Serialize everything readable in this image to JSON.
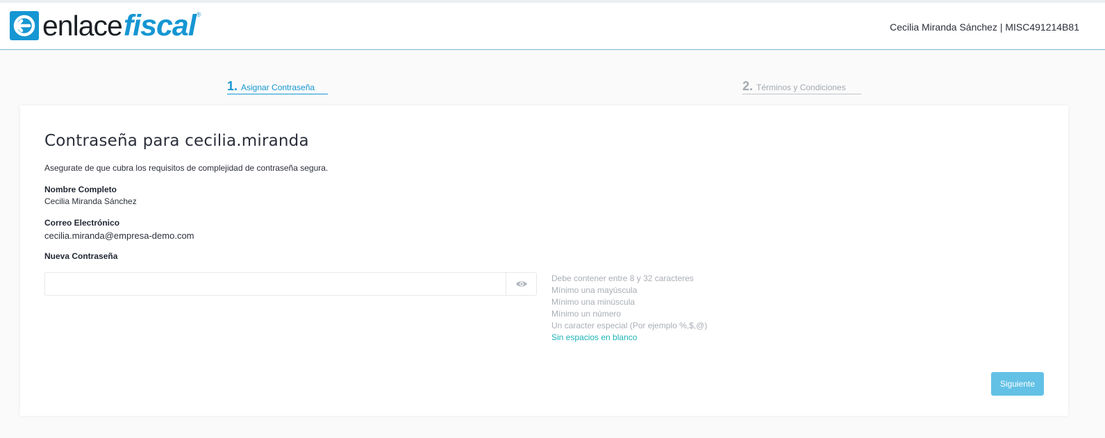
{
  "header": {
    "logo_text_primary": "enlace",
    "logo_text_accent": "fiscal",
    "logo_registered": "®",
    "user_info": "Cecilia Miranda Sánchez | MISC491214B81"
  },
  "steps": [
    {
      "number": "1.",
      "label": "Asignar Contraseña",
      "active": true
    },
    {
      "number": "2.",
      "label": "Términos y Condiciones",
      "active": false
    }
  ],
  "form": {
    "title": "Contraseña para cecilia.miranda",
    "description": "Asegurate de que cubra los requisitos de complejidad de contraseña segura.",
    "full_name_label": "Nombre Completo",
    "full_name_value": "Cecilia Miranda Sánchez",
    "email_label": "Correo Electrónico",
    "email_value": "cecilia.miranda@empresa-demo.com",
    "password_label": "Nueva Contraseña",
    "password_value": "",
    "password_placeholder": "",
    "toggle_icon": "eye-icon",
    "rules": [
      {
        "text": "Debe contener entre 8 y 32 caracteres",
        "met": false
      },
      {
        "text": "Mínimo una mayúscula",
        "met": false
      },
      {
        "text": "Mínimo una minúscula",
        "met": false
      },
      {
        "text": "Mínimo un número",
        "met": false
      },
      {
        "text": "Un caracter especial (Por ejemplo %,$,@)",
        "met": false
      },
      {
        "text": "Sin espacios en blanco",
        "met": true
      }
    ],
    "next_label": "Siguiente"
  },
  "colors": {
    "brand": "#1596d3",
    "rule_met": "#1ab3b8",
    "rule_unmet": "#a9aeb5",
    "button": "#63c1e6"
  }
}
